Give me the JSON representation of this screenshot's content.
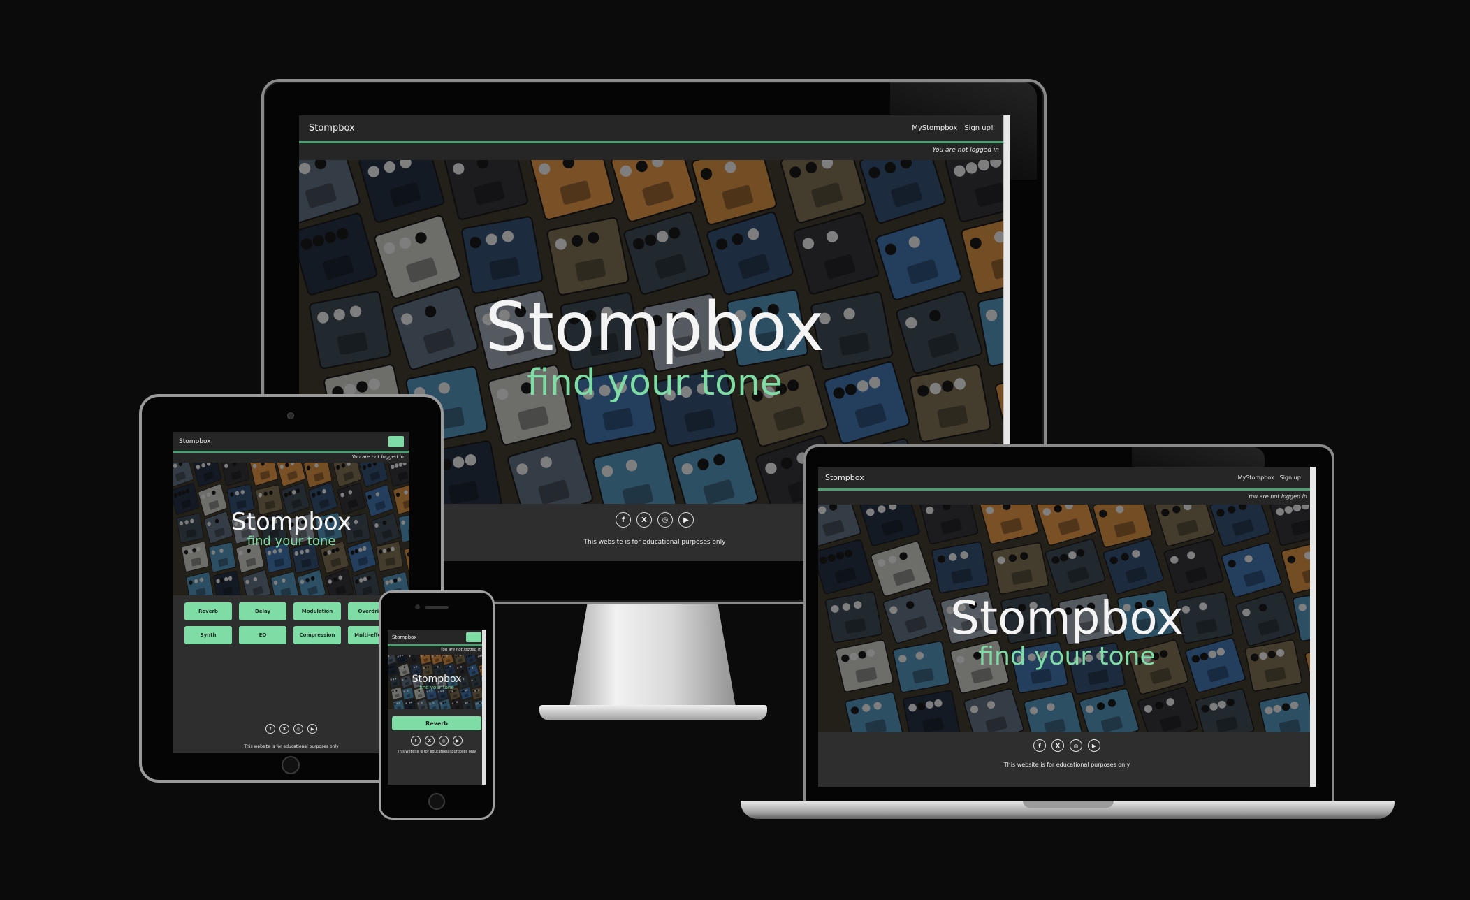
{
  "site": {
    "brand": "Stompbox",
    "nav_links": [
      "MyStompbox",
      "Sign up!"
    ],
    "login_status": "You are not logged in",
    "hero_title": "Stompbox",
    "hero_subtitle": "find your tone",
    "footer_note": "This website is for educational purposes only",
    "social_icons": [
      {
        "name": "facebook-icon",
        "glyph": "f"
      },
      {
        "name": "x-icon",
        "glyph": "X"
      },
      {
        "name": "instagram-icon",
        "glyph": "◎"
      },
      {
        "name": "youtube-icon",
        "glyph": "▶"
      }
    ],
    "categories": [
      "Reverb",
      "Delay",
      "Modulation",
      "Overdrive",
      "Synth",
      "EQ",
      "Compression",
      "Multi-effects"
    ],
    "phone_categories": [
      "Reverb"
    ]
  },
  "colors": {
    "accent": "#7fdca5",
    "accent_line": "#4c9f72",
    "navbar": "#262626",
    "page_bg": "#2e2e2e",
    "backdrop": "#0b0b0b"
  }
}
